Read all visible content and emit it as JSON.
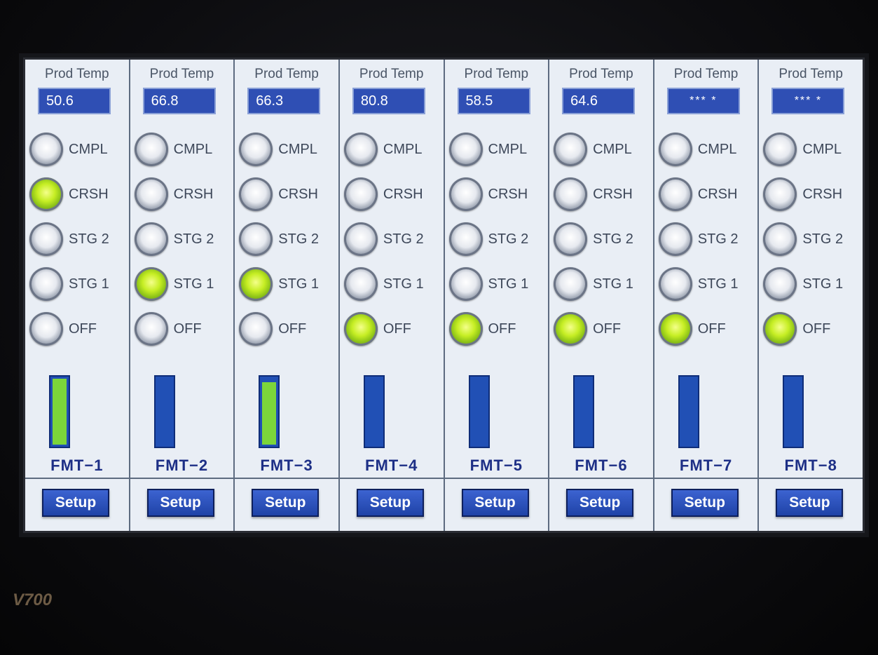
{
  "device": {
    "brand": "V700"
  },
  "columns": [
    {
      "label": "Prod Temp",
      "temp": "50.6",
      "masked": false,
      "active": "CRSH",
      "level": 1.0,
      "name": "FMT−1",
      "button": "Setup"
    },
    {
      "label": "Prod Temp",
      "temp": "66.8",
      "masked": false,
      "active": "STG 1",
      "level": 0.0,
      "name": "FMT−2",
      "button": "Setup"
    },
    {
      "label": "Prod Temp",
      "temp": "66.3",
      "masked": false,
      "active": "STG 1",
      "level": 0.95,
      "name": "FMT−3",
      "button": "Setup"
    },
    {
      "label": "Prod Temp",
      "temp": "80.8",
      "masked": false,
      "active": "OFF",
      "level": 0.0,
      "name": "FMT−4",
      "button": "Setup"
    },
    {
      "label": "Prod Temp",
      "temp": "58.5",
      "masked": false,
      "active": "OFF",
      "level": 0.0,
      "name": "FMT−5",
      "button": "Setup"
    },
    {
      "label": "Prod Temp",
      "temp": "64.6",
      "masked": false,
      "active": "OFF",
      "level": 0.0,
      "name": "FMT−6",
      "button": "Setup"
    },
    {
      "label": "Prod Temp",
      "temp": "*** *",
      "masked": true,
      "active": "OFF",
      "level": 0.0,
      "name": "FMT−7",
      "button": "Setup"
    },
    {
      "label": "Prod Temp",
      "temp": "*** *",
      "masked": true,
      "active": "OFF",
      "level": 0.0,
      "name": "FMT−8",
      "button": "Setup"
    }
  ],
  "stages": [
    "CMPL",
    "CRSH",
    "STG 2",
    "STG 1",
    "OFF"
  ],
  "colors": {
    "lamp_on": "#c6ee24",
    "lamp_off": "#e6e9ef",
    "bar_empty": "#2150b5",
    "bar_fill": "#7cd63a",
    "temp_box": "#2f4fb4",
    "button": "#1f43a7",
    "fmt_label": "#1d2f86"
  }
}
